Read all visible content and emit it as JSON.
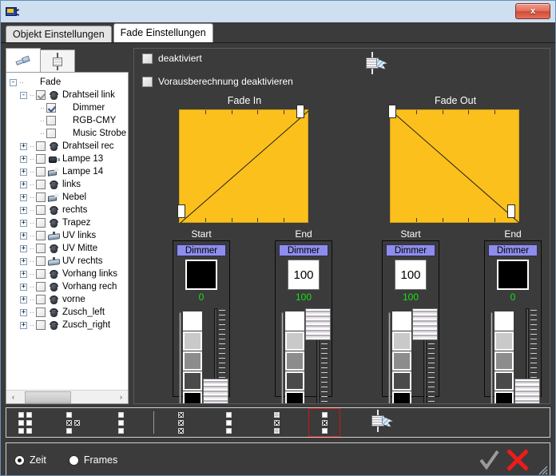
{
  "window": {
    "app_icon": "projector-icon",
    "close_label": "x"
  },
  "tabs": [
    {
      "label": "Objekt Einstellungen",
      "active": false
    },
    {
      "label": "Fade Einstellungen",
      "active": true
    }
  ],
  "left_panel": {
    "tabs": [
      {
        "name": "tools-tab",
        "icon": "wrench-icon",
        "active": true
      },
      {
        "name": "fader-tab",
        "icon": "fader-icon",
        "active": false
      }
    ],
    "tree": [
      {
        "label": "Fade",
        "depth": 0,
        "expander": "-",
        "checkbox": "none",
        "icon": "none"
      },
      {
        "label": "Drahtseil link",
        "depth": 1,
        "expander": "-",
        "checkbox": "checked-gray",
        "icon": "par-icon"
      },
      {
        "label": "Dimmer",
        "depth": 2,
        "expander": "",
        "checkbox": "checked",
        "icon": "none"
      },
      {
        "label": "RGB-CMY",
        "depth": 2,
        "expander": "",
        "checkbox": "unchecked",
        "icon": "none"
      },
      {
        "label": "Music Strobe",
        "depth": 2,
        "expander": "",
        "checkbox": "unchecked",
        "icon": "none"
      },
      {
        "label": "Drahtseil rec",
        "depth": 1,
        "expander": "+",
        "checkbox": "unchecked",
        "icon": "par-icon"
      },
      {
        "label": "Lampe 13",
        "depth": 1,
        "expander": "+",
        "checkbox": "unchecked",
        "icon": "projector-icon"
      },
      {
        "label": "Lampe 14",
        "depth": 1,
        "expander": "+",
        "checkbox": "unchecked",
        "icon": "smoke-icon"
      },
      {
        "label": "links",
        "depth": 1,
        "expander": "+",
        "checkbox": "unchecked",
        "icon": "par-icon"
      },
      {
        "label": "Nebel",
        "depth": 1,
        "expander": "+",
        "checkbox": "unchecked",
        "icon": "smoke-icon"
      },
      {
        "label": "rechts",
        "depth": 1,
        "expander": "+",
        "checkbox": "unchecked",
        "icon": "par-icon"
      },
      {
        "label": "Trapez",
        "depth": 1,
        "expander": "+",
        "checkbox": "unchecked",
        "icon": "par-icon"
      },
      {
        "label": "UV links",
        "depth": 1,
        "expander": "+",
        "checkbox": "unchecked",
        "icon": "bar-icon"
      },
      {
        "label": "UV Mitte",
        "depth": 1,
        "expander": "+",
        "checkbox": "unchecked",
        "icon": "par-icon"
      },
      {
        "label": "UV rechts",
        "depth": 1,
        "expander": "+",
        "checkbox": "unchecked",
        "icon": "bar-icon"
      },
      {
        "label": "Vorhang links",
        "depth": 1,
        "expander": "+",
        "checkbox": "unchecked",
        "icon": "par-icon"
      },
      {
        "label": "Vorhang rech",
        "depth": 1,
        "expander": "+",
        "checkbox": "unchecked",
        "icon": "par-icon"
      },
      {
        "label": "vorne",
        "depth": 1,
        "expander": "+",
        "checkbox": "unchecked",
        "icon": "par-icon"
      },
      {
        "label": "Zusch_left",
        "depth": 1,
        "expander": "+",
        "checkbox": "unchecked",
        "icon": "par-icon"
      },
      {
        "label": "Zusch_right",
        "depth": 1,
        "expander": "+",
        "checkbox": "unchecked",
        "icon": "par-icon"
      }
    ],
    "scrollbar": {
      "left_arrow": "‹",
      "right_arrow": "›"
    }
  },
  "options": {
    "deaktiviert": {
      "label": "deaktiviert",
      "checked": false
    },
    "vorausberechnung": {
      "label": "Vorausberechnung deaktivieren",
      "checked": false
    }
  },
  "chart_data": [
    {
      "type": "line",
      "title": "Fade In",
      "x": [
        0,
        100
      ],
      "values": [
        0,
        100
      ],
      "xlim": [
        0,
        100
      ],
      "ylim": [
        0,
        100
      ],
      "grid": false,
      "fill_color": "#fbc01c",
      "line_color": "#1a1a1a",
      "handles": [
        {
          "name": "start-handle",
          "x": 0,
          "y": 0
        },
        {
          "name": "end-handle",
          "x": 100,
          "y": 100
        }
      ],
      "xtick_count": 5
    },
    {
      "type": "line",
      "title": "Fade Out",
      "x": [
        0,
        100
      ],
      "values": [
        100,
        0
      ],
      "xlim": [
        0,
        100
      ],
      "ylim": [
        0,
        100
      ],
      "grid": false,
      "fill_color": "#fbc01c",
      "line_color": "#1a1a1a",
      "handles": [
        {
          "name": "start-handle",
          "x": 0,
          "y": 100
        },
        {
          "name": "end-handle",
          "x": 100,
          "y": 0
        }
      ],
      "xtick_count": 5
    }
  ],
  "channels": [
    {
      "caption": "Start",
      "header": "Dimmer",
      "mode": "swatch",
      "value": "",
      "readout": "0",
      "swatch_color": "#000000",
      "slider_pct": 0
    },
    {
      "caption": "End",
      "header": "Dimmer",
      "mode": "field",
      "value": "100",
      "readout": "100",
      "swatch_color": "#ffffff",
      "slider_pct": 100
    },
    {
      "caption": "Start",
      "header": "Dimmer",
      "mode": "field",
      "value": "100",
      "readout": "100",
      "swatch_color": "#ffffff",
      "slider_pct": 100
    },
    {
      "caption": "End",
      "header": "Dimmer",
      "mode": "swatch",
      "value": "",
      "readout": "0",
      "swatch_color": "#000000",
      "slider_pct": 0
    }
  ],
  "preset_colors": [
    "#ffffff",
    "#c9c9c9",
    "#8c8c8c",
    "#4a4a4a",
    "#000000"
  ],
  "icon_toolbar": {
    "buttons": [
      {
        "name": "grid-offset-left-button",
        "icon": "dot-matrix-icon",
        "selected": false
      },
      {
        "name": "grid-center-button",
        "icon": "dot-matrix-icon",
        "selected": false
      },
      {
        "name": "grid-column-button",
        "icon": "dot-matrix-icon",
        "selected": false
      },
      {
        "name": "grid-all-hatched-button",
        "icon": "dot-matrix-icon",
        "selected": false
      },
      {
        "name": "grid-plain-column-button",
        "icon": "dot-matrix-icon",
        "selected": false
      },
      {
        "name": "grid-ring-column-button",
        "icon": "dot-matrix-icon",
        "selected": false
      },
      {
        "name": "grid-middle-hatch-button",
        "icon": "dot-matrix-icon",
        "selected": true
      }
    ],
    "fader_hand_icon": "fader-hand-icon"
  },
  "bottom_bar": {
    "time_mode": {
      "label": "Zeit",
      "selected": true
    },
    "frames_mode": {
      "label": "Frames",
      "selected": false
    },
    "accept": {
      "name": "accept-button",
      "glyph": "✓"
    },
    "cancel": {
      "name": "cancel-button",
      "glyph": "✕"
    }
  },
  "colors": {
    "chart_fill": "#fbc01c",
    "header_purple": "#8e8eea",
    "readout_green": "#13e413",
    "accent_red": "#ee1b1b",
    "background_dark": "#3b3b3b"
  }
}
